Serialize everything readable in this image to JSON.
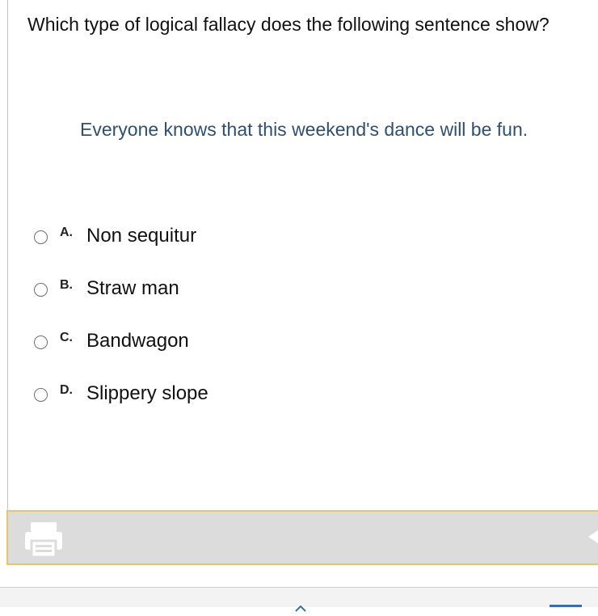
{
  "question": {
    "text": "Which type of logical fallacy does the following sentence show?"
  },
  "passage": {
    "text": "Everyone knows that this weekend's dance will be fun."
  },
  "options": [
    {
      "letter": "A.",
      "text": "Non sequitur"
    },
    {
      "letter": "B.",
      "text": "Straw man"
    },
    {
      "letter": "C.",
      "text": "Bandwagon"
    },
    {
      "letter": "D.",
      "text": "Slippery slope"
    }
  ],
  "toolbar": {
    "print_icon": "printer-icon",
    "next_icon": "arrow-right-icon"
  },
  "colors": {
    "border_accent": "#e3c66d",
    "passage_text": "#2f4f6f",
    "toolbar_bg": "#dcdcdc",
    "link_blue": "#3b6fa8"
  }
}
